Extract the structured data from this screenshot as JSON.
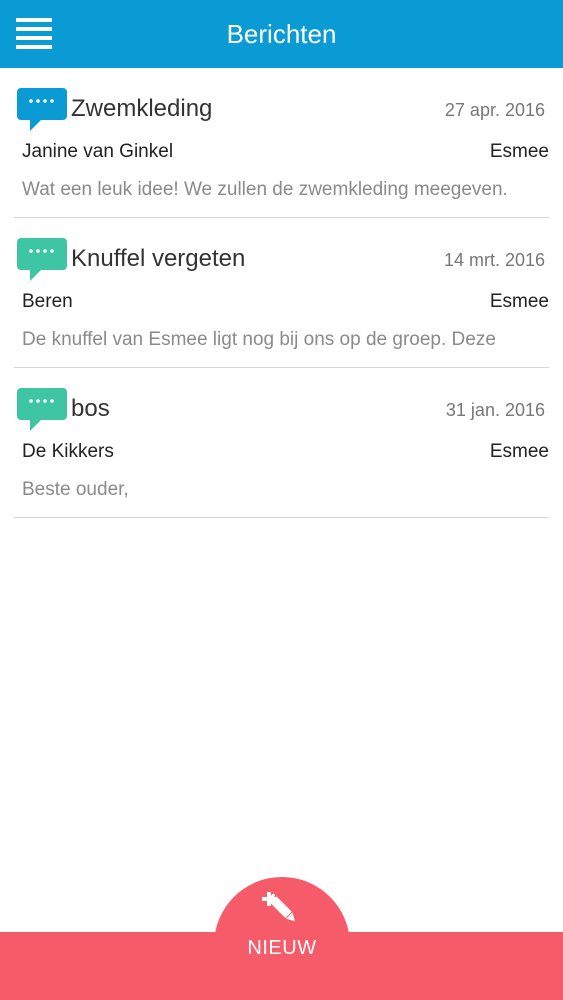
{
  "header": {
    "title": "Berichten",
    "menu_icon": "hamburger-menu-icon",
    "color": "#0b9bd4"
  },
  "messages": [
    {
      "subject": "Zwemkleding",
      "date": "27 apr. 2016",
      "from": "Janine van Ginkel",
      "child": "Esmee",
      "preview": "Wat een leuk idee! We zullen de zwemkleding meegeven.",
      "icon": "speech-bubble-icon",
      "icon_color": "#0b9bd4"
    },
    {
      "subject": "Knuffel vergeten",
      "date": "14 mrt. 2016",
      "from": "Beren",
      "child": "Esmee",
      "preview": "De knuffel van Esmee ligt nog bij ons op de groep. Deze",
      "icon": "speech-bubble-icon",
      "icon_color": "#3ec6a4"
    },
    {
      "subject": "bos",
      "date": "31 jan. 2016",
      "from": "De Kikkers",
      "child": "Esmee",
      "preview": "Beste ouder,",
      "icon": "speech-bubble-icon",
      "icon_color": "#3ec6a4"
    }
  ],
  "footer": {
    "new_label": "NIEUW",
    "new_icon": "compose-pencil-icon",
    "color": "#f65b69"
  }
}
